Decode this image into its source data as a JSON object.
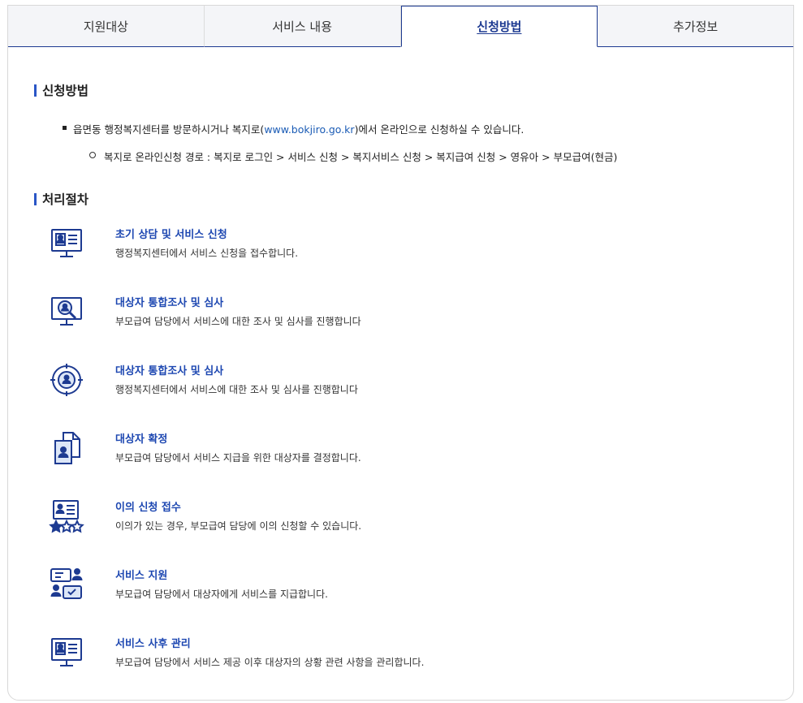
{
  "tabs": [
    {
      "label": "지원대상"
    },
    {
      "label": "서비스 내용"
    },
    {
      "label": "신청방법"
    },
    {
      "label": "추가정보"
    }
  ],
  "apply": {
    "title": "신청방법",
    "line1_before": "읍면동 행정복지센터를 방문하시거나 복지로(",
    "link": "www.bokjiro.go.kr",
    "line1_after": ")에서 온라인으로 신청하실 수 있습니다.",
    "line2": "복지로 온라인신청 경로 : 복지로 로그인 > 서비스 신청 > 복지서비스 신청 > 복지급여 신청 > 영유아 > 부모급여(현금)"
  },
  "process": {
    "title": "처리절차",
    "steps": [
      {
        "title": "초기 상담 및 서비스 신청",
        "desc": "행정복지센터에서 서비스 신청을 접수합니다.",
        "icon": "monitor-profile-icon"
      },
      {
        "title": "대상자 통합조사 및 심사",
        "desc": "부모급여 담당에서 서비스에 대한 조사 및 심사를 진행합니다",
        "icon": "monitor-search-icon"
      },
      {
        "title": "대상자 통합조사 및 심사",
        "desc": "행정복지센터에서 서비스에 대한 조사 및 심사를 진행합니다",
        "icon": "target-person-icon"
      },
      {
        "title": "대상자 확정",
        "desc": "부모급여 담당에서 서비스 지급을 위한 대상자를 결정합니다.",
        "icon": "document-person-icon"
      },
      {
        "title": "이의 신청 접수",
        "desc": "이의가 있는 경우, 부모급여 담당에 이의 신청할 수 있습니다.",
        "icon": "profile-stars-icon"
      },
      {
        "title": "서비스 지원",
        "desc": "부모급여 담당에서 대상자에게 서비스를 지급합니다.",
        "icon": "chat-support-icon"
      },
      {
        "title": "서비스 사후 관리",
        "desc": "부모급여 담당에서 서비스 제공 이후 대상자의 상황 관련 사항을 관리합니다.",
        "icon": "monitor-profile-icon"
      }
    ]
  },
  "colors": {
    "accent": "#1d3a91",
    "title_blue": "#1d47b1",
    "bar": "#2a56c6",
    "link": "#1a5bb5"
  }
}
